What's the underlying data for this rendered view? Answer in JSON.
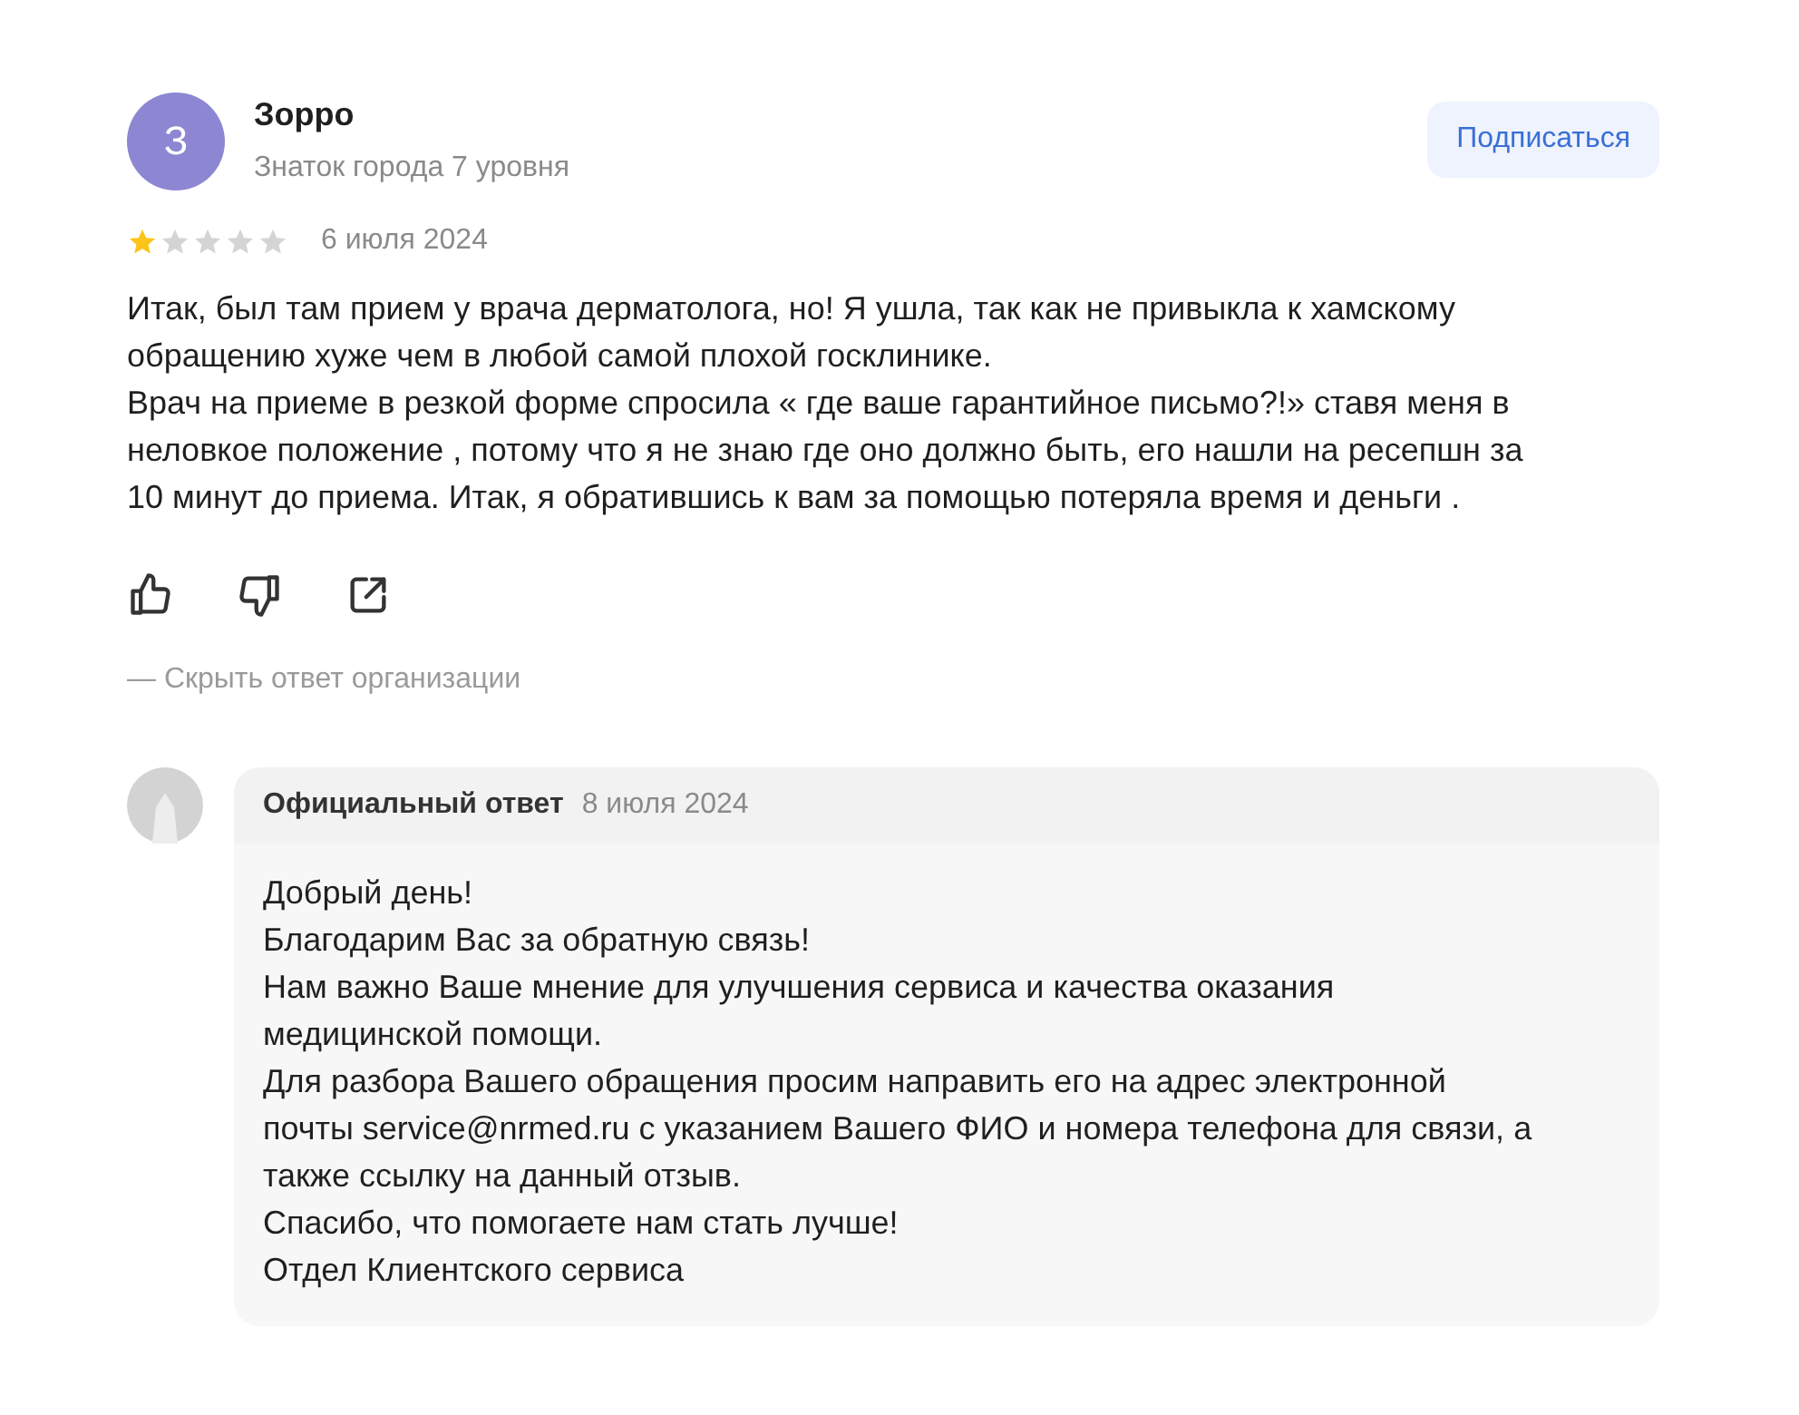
{
  "author": {
    "initial": "З",
    "name": "Зорро",
    "level": "Знаток города 7 уровня"
  },
  "subscribe_button": "Подписаться",
  "review": {
    "stars": 1,
    "date": "6 июля 2024",
    "paragraphs": [
      "Итак, был там прием у врача дерматолога, но! Я ушла, так как не привыкла к хамскому обращению хуже чем в любой самой плохой госклинике.",
      "Врач на приеме в резкой форме спросила « где ваше гарантийное письмо?!» ставя меня в неловкое положение , потому что я не знаю где оно должно быть, его нашли на ресепшн за 10 минут до приема. Итак, я обратившись к вам за помощью потеряла время и деньги ."
    ]
  },
  "hide_answer_link": "— Скрыть ответ организации",
  "answer": {
    "title": "Официальный ответ",
    "date": "8 июля 2024",
    "paragraphs": [
      "Добрый день!",
      "Благодарим Вас за обратную связь!",
      "Нам важно Ваше мнение для улучшения сервиса и качества оказания медицинской помощи.",
      "Для разбора Вашего обращения просим направить его на адрес электронной почты service@nrmed.ru с указанием Вашего ФИО и номера телефона для связи, а также ссылку на данный отзыв.",
      "Спасибо, что помогаете нам стать лучше!",
      "Отдел Клиентского сервиса"
    ]
  }
}
